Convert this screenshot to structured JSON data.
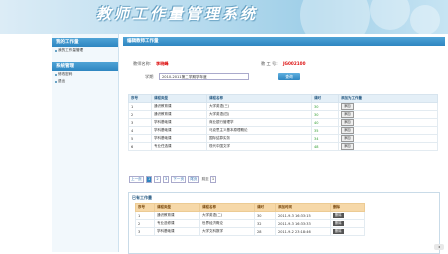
{
  "app": {
    "title": "教师工作量管理系统"
  },
  "sidebar": {
    "sections": [
      {
        "heading": "我的工作量",
        "items": [
          "我的工作量管理"
        ]
      },
      {
        "heading": "系统管理",
        "items": [
          "修改密码",
          "退出"
        ]
      }
    ]
  },
  "main": {
    "heading": "编辑教师工作量",
    "teacher_label": "教师名称:",
    "teacher_name": "李晓峰",
    "teacher_id_label": "教 工 号:",
    "teacher_id": "JG002100",
    "term_label": "学期",
    "term_value": "2010-2011第二学期学年度",
    "query_button": "查询"
  },
  "course_table": {
    "headers": [
      "序号",
      "课程类型",
      "课程名称",
      "课时",
      "添加为工作量"
    ],
    "rows": [
      {
        "no": "1",
        "type": "通识教育课",
        "name": "大学英语(三)",
        "hours": "30",
        "action": "添加"
      },
      {
        "no": "2",
        "type": "通识教育课",
        "name": "大学英语(四)",
        "hours": "30",
        "action": "添加"
      },
      {
        "no": "3",
        "type": "学科基础课",
        "name": "商业银行管理学",
        "hours": "40",
        "action": "添加"
      },
      {
        "no": "4",
        "type": "学科基础课",
        "name": "马克思主义基本原理概论",
        "hours": "35",
        "action": "添加"
      },
      {
        "no": "5",
        "type": "学科基础课",
        "name": "国际结算实务",
        "hours": "34",
        "action": "添加"
      },
      {
        "no": "6",
        "type": "专业任选课",
        "name": "现代中国文学",
        "hours": "48",
        "action": "添加"
      }
    ]
  },
  "pager": {
    "prev_label": "上一页",
    "pages": [
      "1",
      "2",
      "3"
    ],
    "next_label": "下一页",
    "last_label": "尾页",
    "jump_label": "跳至",
    "jump_value": "1"
  },
  "workload": {
    "title": "已有工作量",
    "headers": [
      "序号",
      "课程类型",
      "课程名称",
      "课时",
      "添加时间",
      "删除"
    ],
    "rows": [
      {
        "no": "1",
        "type": "通识教育课",
        "name": "大学英语(二)",
        "hours": "30",
        "time": "2011-9-3 16:33:15",
        "action": "删除"
      },
      {
        "no": "2",
        "type": "专业选修课",
        "name": "世界经济概论",
        "hours": "32",
        "time": "2011-9-3 16:33:33",
        "action": "删除"
      },
      {
        "no": "3",
        "type": "学科基础课",
        "name": "大学文科数学",
        "hours": "28",
        "time": "2011-9-2 23:18:46",
        "action": "删除"
      }
    ]
  }
}
